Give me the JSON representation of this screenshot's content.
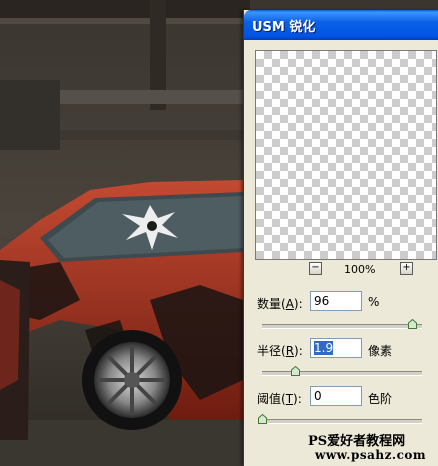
{
  "dialog": {
    "title": "USM 锐化",
    "zoom": "100%",
    "amount": {
      "label_prefix": "数量(",
      "accel": "A",
      "label_suffix": "):",
      "value": "96",
      "unit": "%",
      "slider_value": 96
    },
    "radius": {
      "label_prefix": "半径(",
      "accel": "R",
      "label_suffix": "):",
      "value": "1.9",
      "unit": "像素",
      "slider_value": 1.9
    },
    "threshold": {
      "label_prefix": "阈值(",
      "accel": "T",
      "label_suffix": "):",
      "value": "0",
      "unit": "色阶",
      "slider_value": 0
    }
  },
  "watermark": {
    "line1": "PS爱好者教程网",
    "line2": "www.psahz.com"
  },
  "colors": {
    "title_bar": "#0054e3",
    "dialog_bg": "#ece9d8",
    "car_red": "#b23420"
  }
}
